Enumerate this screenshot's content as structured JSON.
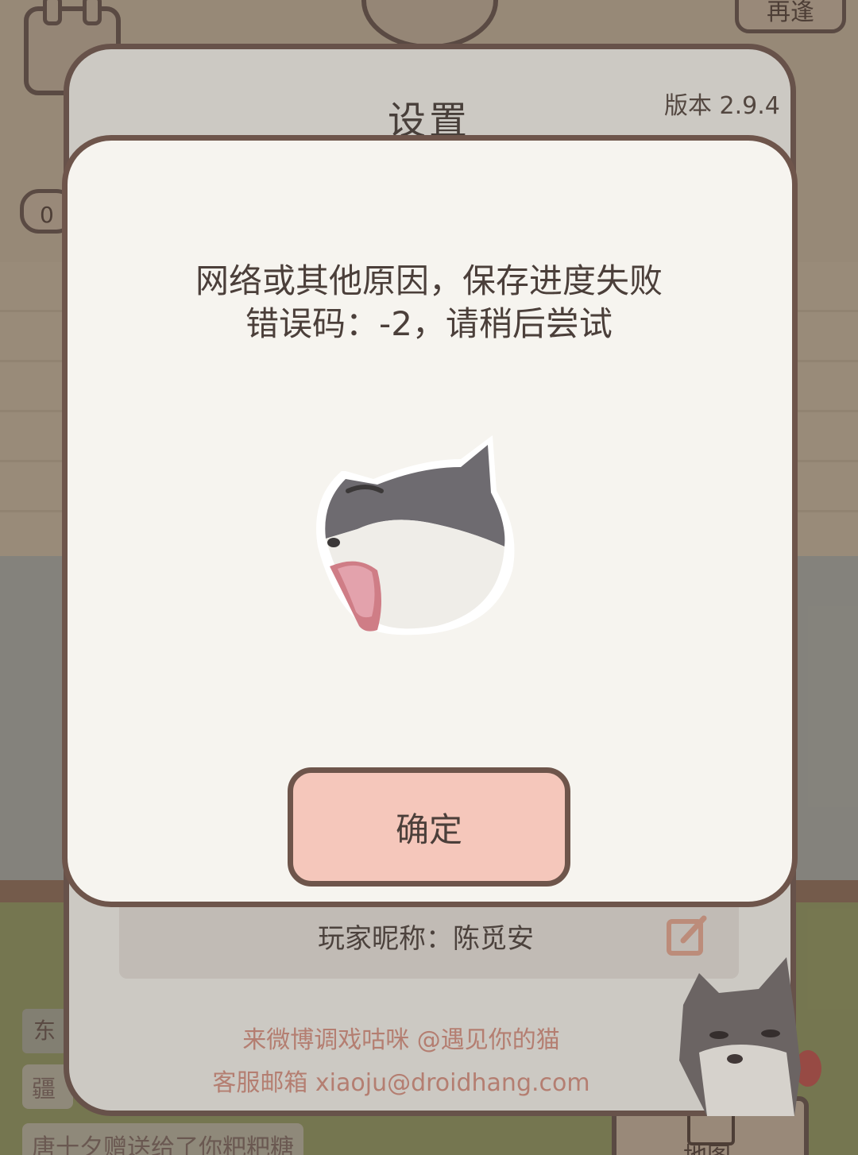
{
  "background": {
    "top_button_label": "再逢",
    "count_label": "0",
    "side_label": "东",
    "message_1": "疆",
    "message_2": "唐十夕赠送给了你粑粑糖",
    "map_label": "地图"
  },
  "settings": {
    "title": "设置",
    "version": "版本 2.9.4",
    "nickname": "玩家昵称：陈觅安",
    "weibo": "来微博调戏咕咪 @遇见你的猫",
    "email": "客服邮箱 xiaoju@droidhang.com"
  },
  "dialog": {
    "message_line1": "网络或其他原因，保存进度失败",
    "message_line2": "错误码：-2，请稍后尝试",
    "confirm_label": "确定"
  },
  "colors": {
    "panel_border": "#6e554b",
    "confirm_bg": "#f5c7bb",
    "link_text": "#c9897a"
  }
}
